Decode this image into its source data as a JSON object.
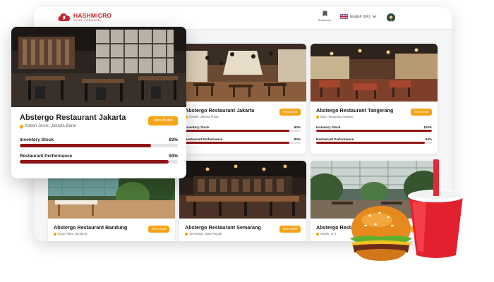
{
  "header": {
    "brand_name": "HASHMICRO",
    "brand_tagline": "THINK FORWARD",
    "bookmark_label": "Bookmark",
    "language_label": "English (UK)"
  },
  "colors": {
    "brand_red": "#c0272d",
    "accent_orange": "#f5a416",
    "bar_fill": "#8f1515",
    "bar_track": "#e4e4e4"
  },
  "featured_card": {
    "title": "Abstergo Restaurant Jakarta",
    "location": "Kebon Jeruk, Jakarta Barat",
    "view_label": "View Detail",
    "metrics": [
      {
        "label": "Inventory Stock",
        "value": "83%",
        "level": 0.83
      },
      {
        "label": "Restaurant Performance",
        "value": "94%",
        "level": 0.94
      }
    ]
  },
  "cards": [
    {
      "title": "Abstergo Restaurant Jakarta",
      "location": "Gambir, Jakarta Pusat",
      "view_label": "View Detail",
      "metrics": [
        {
          "label": "Inventory Stock",
          "value": "90%",
          "level": 0.9
        },
        {
          "label": "Restaurant Performance",
          "value": "90%",
          "level": 0.9
        }
      ]
    },
    {
      "title": "Abstergo Restaurant Tangerang",
      "location": "BSD, Tangerang Selatan",
      "view_label": "View Detail",
      "metrics": [
        {
          "label": "Inventory Stock",
          "value": "100%",
          "level": 1.0
        },
        {
          "label": "Restaurant Performance",
          "value": "94%",
          "level": 0.94
        }
      ]
    },
    {
      "title": "Abstergo Restaurant Bandung",
      "location": "Dago Pakar, Bandung",
      "view_label": "View Detail"
    },
    {
      "title": "Abstergo Restaurant Semarang",
      "location": "Semarang, Jawa Tengah",
      "view_label": "View Detail"
    },
    {
      "title": "Abstergo Restaurant Depok",
      "location": "Depok, 17.1",
      "view_label": "View Detail"
    }
  ]
}
